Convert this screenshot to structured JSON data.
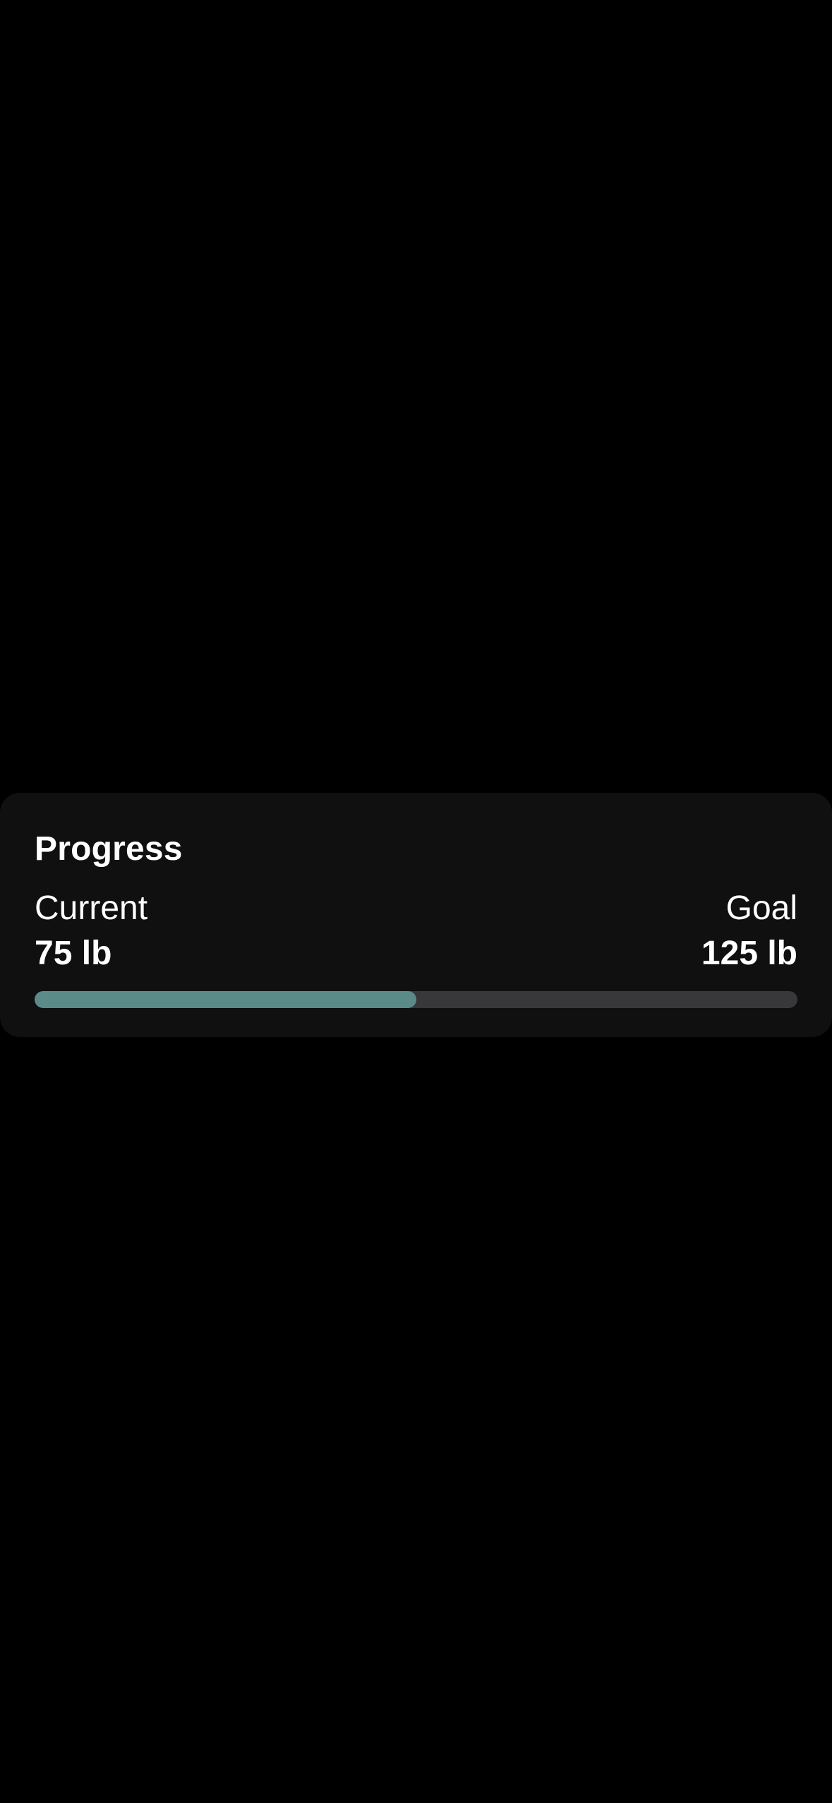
{
  "progress_card": {
    "title": "Progress",
    "current_label": "Current",
    "current_value": "75 lb",
    "goal_label": "Goal",
    "goal_value": "125 lb",
    "progress_fraction": 0.5
  },
  "colors": {
    "background": "#000000",
    "card_background": "#101010",
    "track": "#38383a",
    "fill": "#5b8b88",
    "text": "#ffffff"
  }
}
